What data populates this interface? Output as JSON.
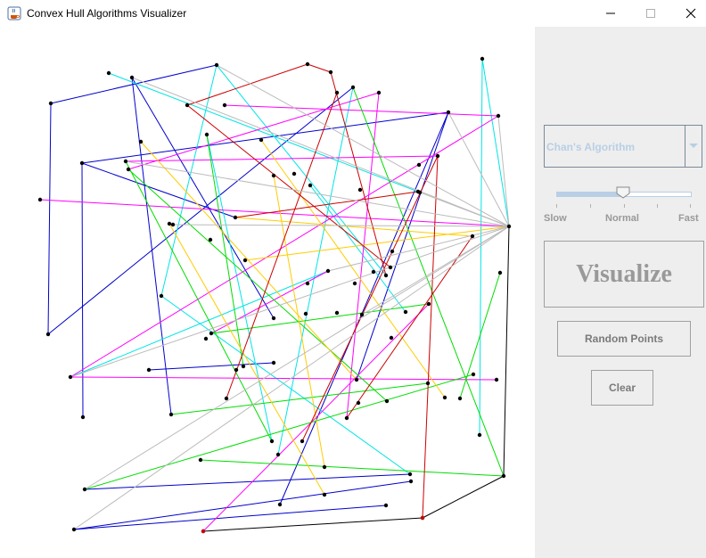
{
  "window": {
    "title": "Convex Hull Algorithms Visualizer",
    "icon": "java-cup-icon",
    "controls": [
      "minimize-icon",
      "maximize-icon",
      "close-icon"
    ]
  },
  "controls": {
    "algorithm_select": {
      "selected": "Chan's Algorithm",
      "enabled": false
    },
    "speed_slider": {
      "labels": [
        "Slow",
        "Normal",
        "Fast"
      ],
      "value": 0.5
    },
    "visualize_label": "Visualize",
    "random_points_label": "Random Points",
    "clear_label": "Clear"
  },
  "colors": {
    "point_fill": "#000000",
    "segment_palette": [
      "#0000cc",
      "#00e5e5",
      "#ff00ff",
      "#00dd00",
      "#ffcc00",
      "#cc0000",
      "#bbbbbb",
      "#000000"
    ],
    "slider_accent": "#b8cfe5",
    "panel_bg": "#eeeeee"
  }
}
